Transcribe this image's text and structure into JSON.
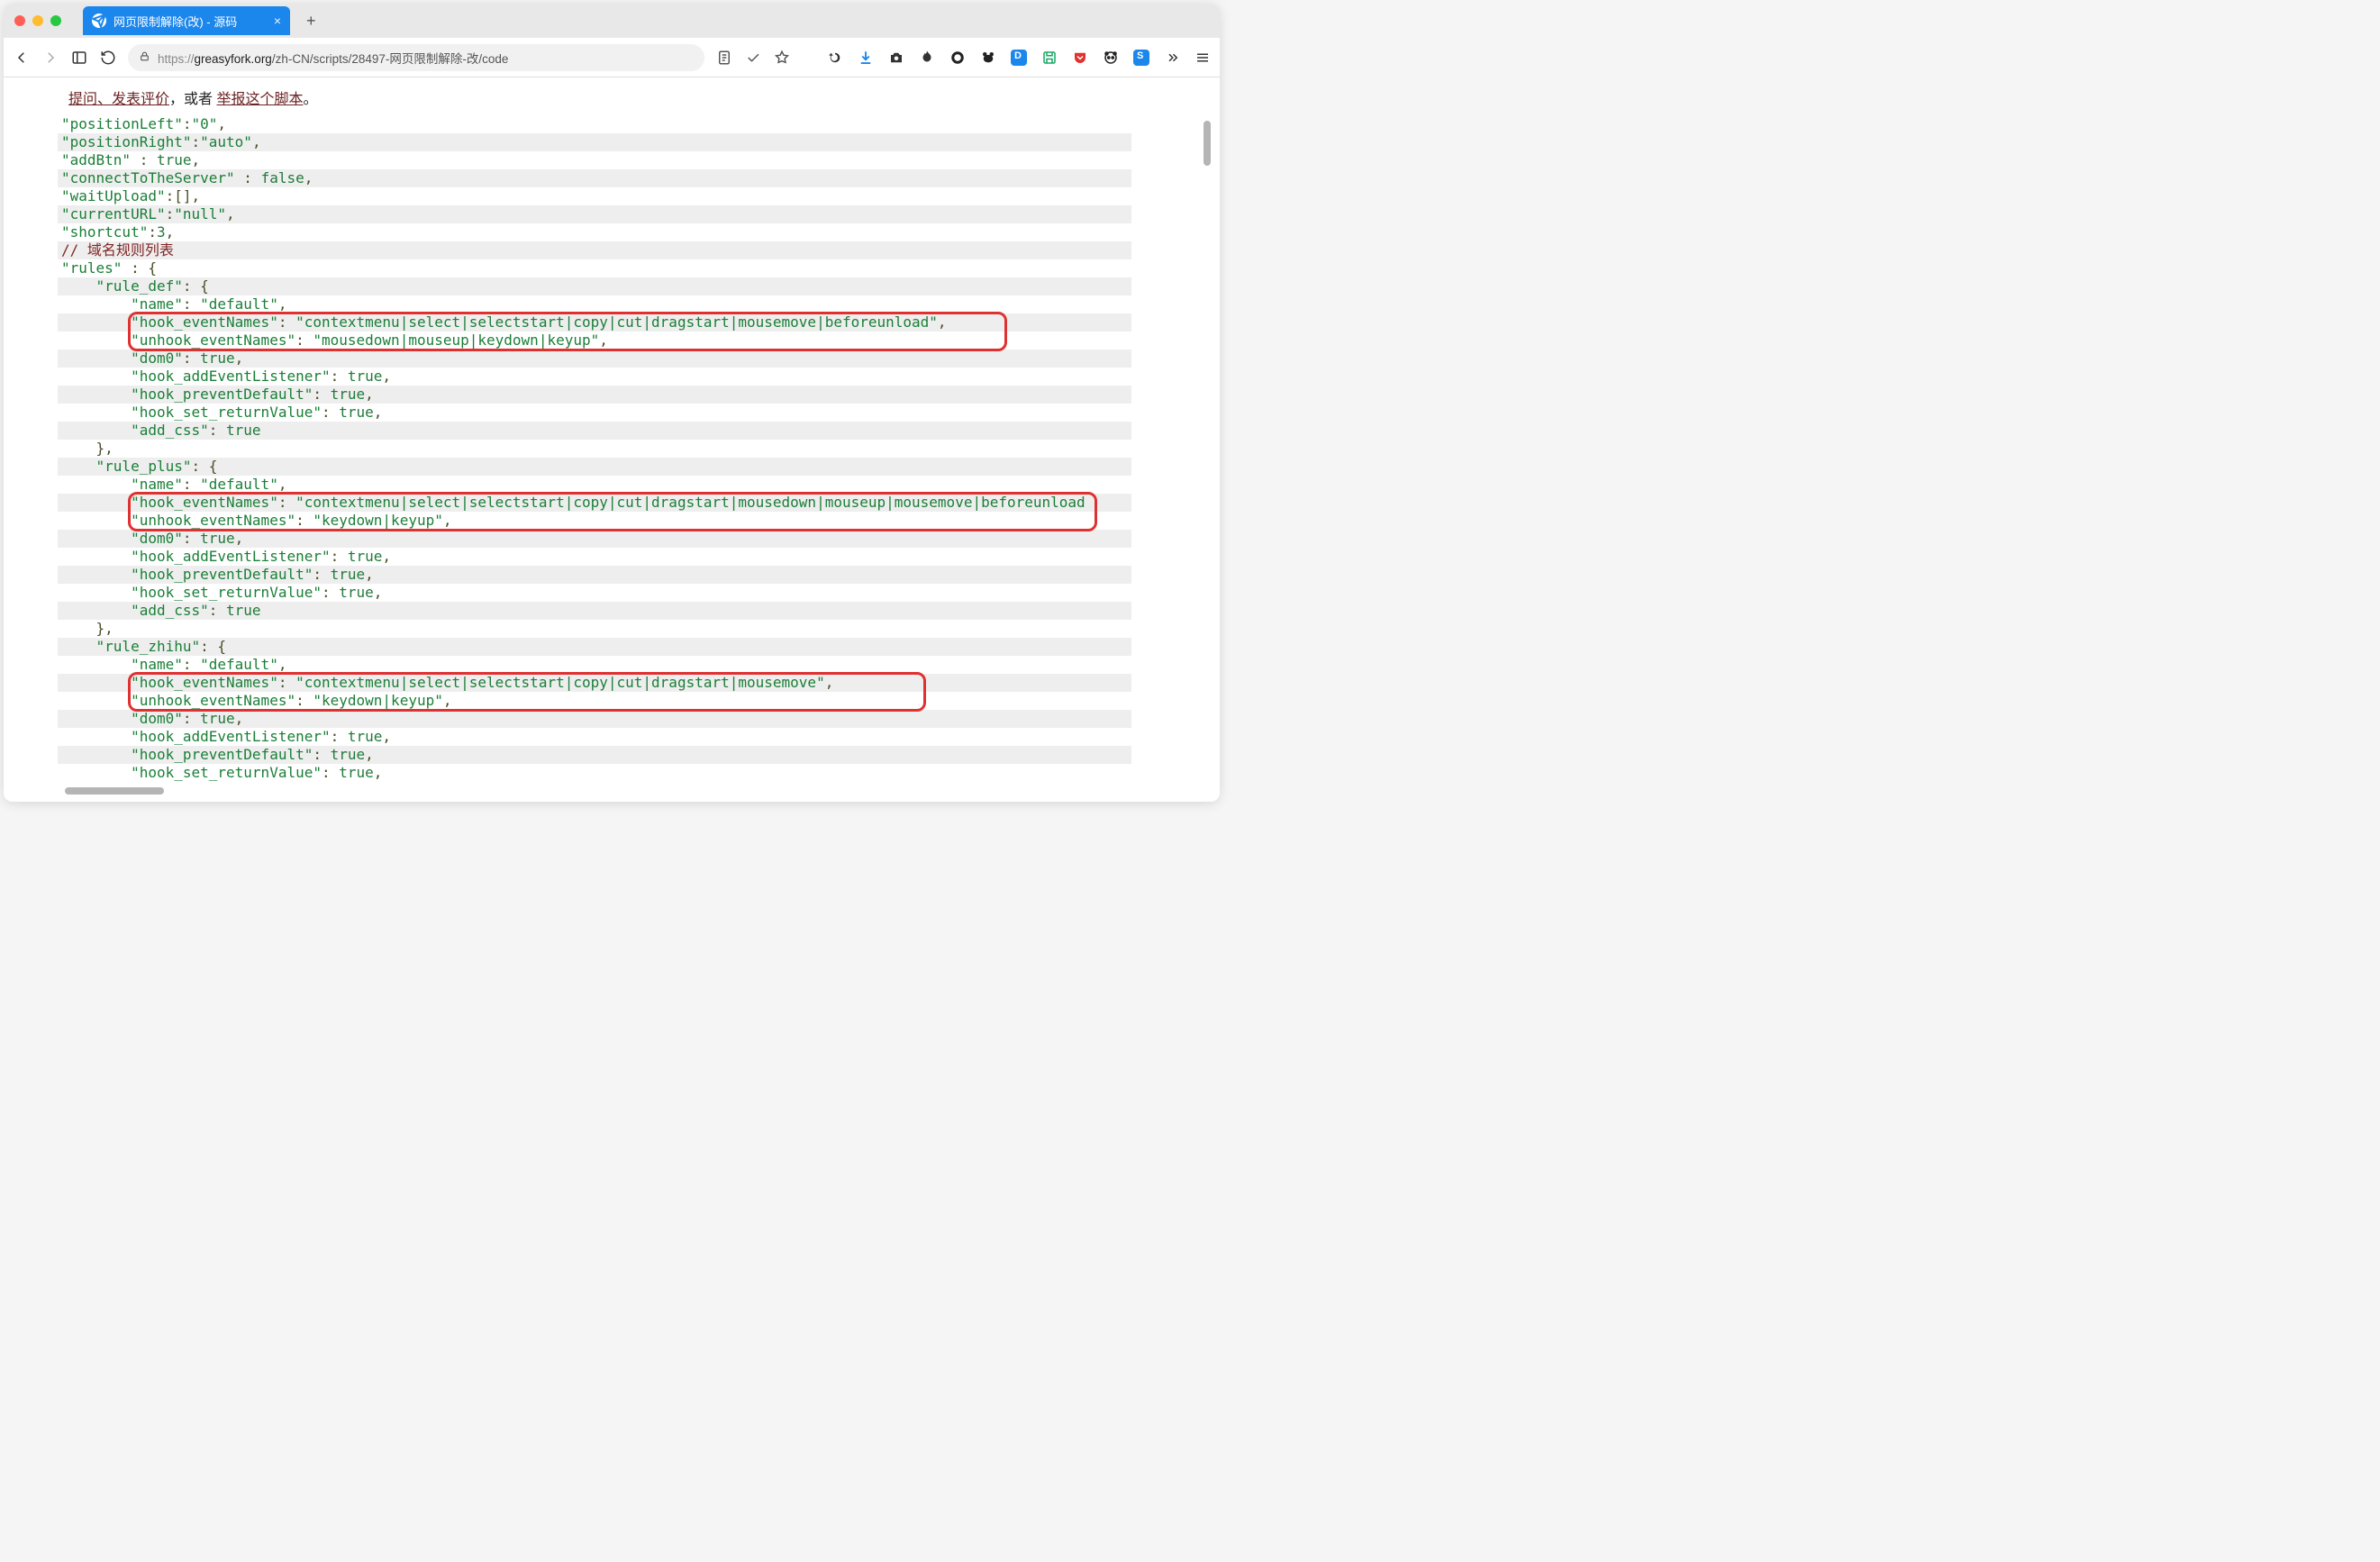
{
  "tab": {
    "title": "网页限制解除(改) - 源码"
  },
  "url": {
    "scheme": "https://",
    "host": "greasyfork.org",
    "path": "/zh-CN/scripts/28497-网页限制解除-改/code"
  },
  "header": {
    "link1": "提问、发表评价",
    "mid": "，或者 ",
    "link2": "举报这个脚本",
    "end": "。"
  },
  "code": {
    "positionLeft_k": "\"positionLeft\"",
    "positionLeft_v": "\"0\"",
    "positionRight_k": "\"positionRight\"",
    "positionRight_v": "\"auto\"",
    "addBtn_k": "\"addBtn\"",
    "addBtn_v": "true",
    "cts_k": "\"connectToTheServer\"",
    "cts_v": "false",
    "waitUpload_k": "\"waitUpload\"",
    "currentURL_k": "\"currentURL\"",
    "currentURL_v": "\"null\"",
    "shortcut_k": "\"shortcut\"",
    "shortcut_v": "3",
    "comment_domain": "// 域名规则列表",
    "rules_k": "\"rules\"",
    "rule_def_k": "\"rule_def\"",
    "rule_plus_k": "\"rule_plus\"",
    "rule_zhihu_k": "\"rule_zhihu\"",
    "name_k": "\"name\"",
    "name_v": "\"default\"",
    "hook_eventNames_k": "\"hook_eventNames\"",
    "unhook_eventNames_k": "\"unhook_eventNames\"",
    "dom0_k": "\"dom0\"",
    "hook_addEL_k": "\"hook_addEventListener\"",
    "hook_prevDef_k": "\"hook_preventDefault\"",
    "hook_setRet_k": "\"hook_set_returnValue\"",
    "add_css_k": "\"add_css\"",
    "true_v": "true",
    "hook_def_v": "\"contextmenu|select|selectstart|copy|cut|dragstart|mousemove|beforeunload\"",
    "unhook_def_v": "\"mousedown|mouseup|keydown|keyup\"",
    "hook_plus_v": "\"contextmenu|select|selectstart|copy|cut|dragstart|mousedown|mouseup|mousemove|beforeunload",
    "unhook_plus_v": "\"keydown|keyup\"",
    "hook_zhihu_v": "\"contextmenu|select|selectstart|copy|cut|dragstart|mousemove\"",
    "unhook_zhihu_v": "\"keydown|keyup\""
  }
}
